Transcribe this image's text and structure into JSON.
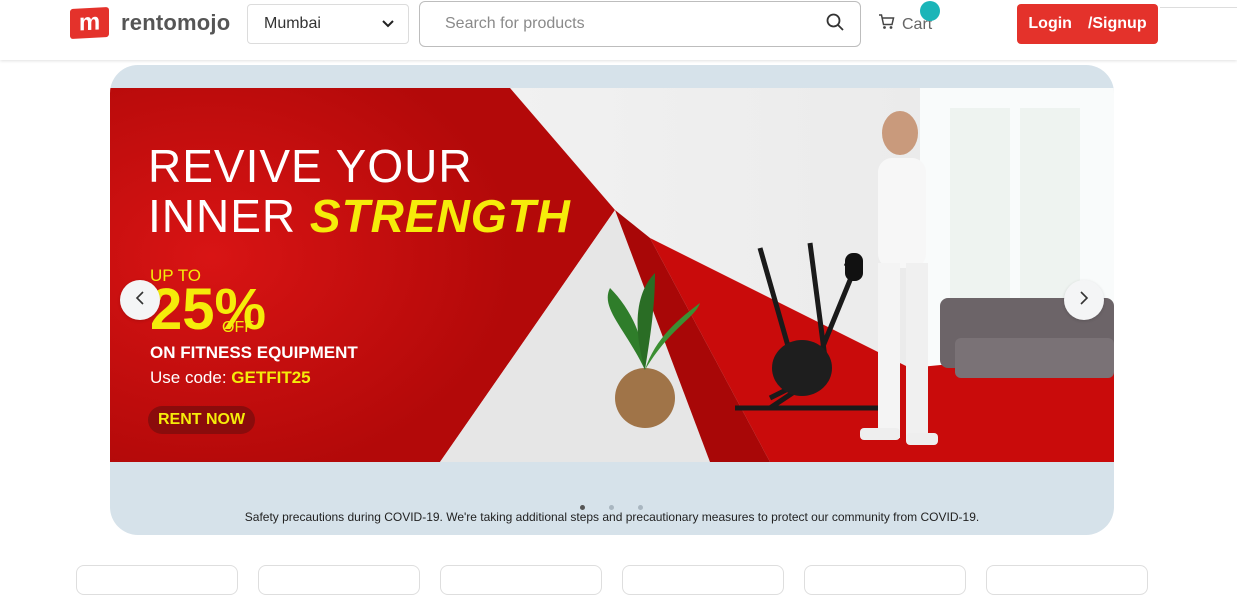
{
  "header": {
    "logo_letter": "m",
    "brand": "rentomojo",
    "city": "Mumbai",
    "search_placeholder": "Search for products",
    "cart_label": "Cart",
    "login_label": "Login",
    "signup_label": "/Signup"
  },
  "banner": {
    "line1": "REVIVE YOUR",
    "line2_plain": "INNER ",
    "line2_highlight": "STRENGTH",
    "up_to": "UP TO",
    "percent": "25%",
    "off": "OFF",
    "category": "ON FITNESS EQUIPMENT",
    "code_prefix": "Use code: ",
    "code": "GETFIT25",
    "cta": "RENT NOW"
  },
  "carousel": {
    "slide_count": 3,
    "active_index": 0
  },
  "notice": "Safety precautions during COVID-19. We're taking additional steps and precautionary measures to protect our community from COVID-19.",
  "colors": {
    "brand_red": "#e4322b",
    "banner_red": "#c40a0a",
    "highlight_yellow": "#f5ec0a",
    "cart_badge": "#1bb5b8"
  },
  "icons": [
    "chevron-down-icon",
    "search-icon",
    "cart-icon",
    "chevron-left-icon",
    "chevron-right-icon"
  ]
}
